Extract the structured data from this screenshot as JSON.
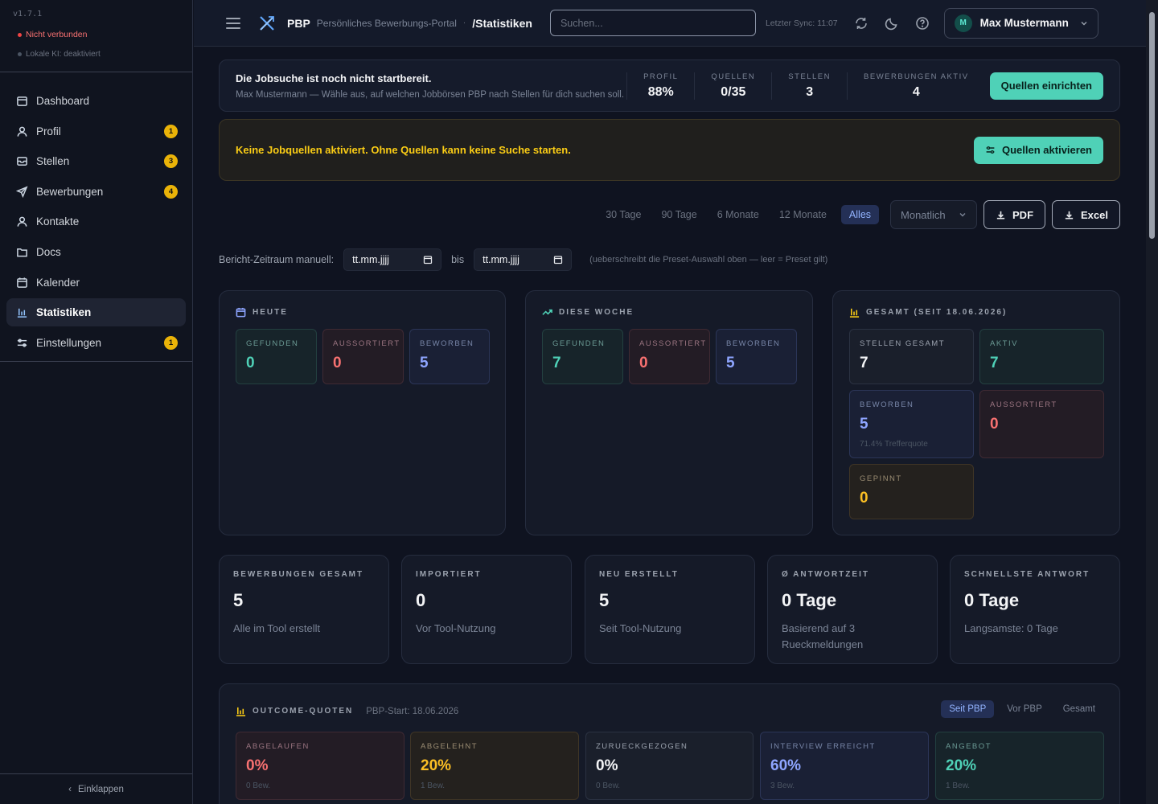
{
  "sidebar": {
    "version": "v1.7.1",
    "connection": "Nicht verbunden",
    "local_ai": "Lokale KI: deaktiviert",
    "items": [
      {
        "label": "Dashboard",
        "badge": ""
      },
      {
        "label": "Profil",
        "badge": "1"
      },
      {
        "label": "Stellen",
        "badge": "3"
      },
      {
        "label": "Bewerbungen",
        "badge": "4"
      },
      {
        "label": "Kontakte",
        "badge": ""
      },
      {
        "label": "Docs",
        "badge": ""
      },
      {
        "label": "Kalender",
        "badge": ""
      },
      {
        "label": "Statistiken",
        "badge": ""
      },
      {
        "label": "Einstellungen",
        "badge": "1"
      }
    ],
    "collapse": "Einklappen"
  },
  "header": {
    "brand": "PBP",
    "brand_sub": "Persönliches Bewerbungs-Portal",
    "breadcrumb_sep": "·",
    "crumb": "/Statistiken",
    "search_placeholder": "Suchen...",
    "sync": "Letzter Sync: 11:07",
    "avatar": "M",
    "user": "Max Mustermann"
  },
  "ready": {
    "title": "Die Jobsuche ist noch nicht startbereit.",
    "subtitle": "Max Mustermann — Wähle aus, auf welchen Jobbörsen PBP nach Stellen für dich suchen soll.",
    "kpis": [
      {
        "label": "PROFIL",
        "value": "88%"
      },
      {
        "label": "QUELLEN",
        "value": "0/35"
      },
      {
        "label": "STELLEN",
        "value": "3"
      },
      {
        "label": "BEWERBUNGEN AKTIV",
        "value": "4"
      }
    ],
    "button": "Quellen einrichten"
  },
  "warning": {
    "text": "Keine Jobquellen aktiviert. Ohne Quellen kann keine Suche starten.",
    "button": "Quellen aktivieren"
  },
  "filters": {
    "presets": [
      "30 Tage",
      "90 Tage",
      "6 Monate",
      "12 Monate",
      "Alles"
    ],
    "active": "Alles",
    "interval": "Monatlich",
    "pdf": "PDF",
    "excel": "Excel"
  },
  "range": {
    "label": "Bericht-Zeitraum manuell:",
    "from": "tt.mm.jjjj",
    "to_label": "bis",
    "to": "tt.mm.jjjj",
    "note": "(ueberschreibt die Preset-Auswahl oben — leer = Preset gilt)"
  },
  "today": {
    "title": "HEUTE",
    "cards": [
      {
        "label": "GEFUNDEN",
        "value": "0"
      },
      {
        "label": "AUSSORTIERT",
        "value": "0"
      },
      {
        "label": "BEWORBEN",
        "value": "5"
      }
    ]
  },
  "week": {
    "title": "DIESE WOCHE",
    "cards": [
      {
        "label": "GEFUNDEN",
        "value": "7"
      },
      {
        "label": "AUSSORTIERT",
        "value": "0"
      },
      {
        "label": "BEWORBEN",
        "value": "5"
      }
    ]
  },
  "total": {
    "title": "GESAMT (SEIT 18.06.2026)",
    "cards": [
      {
        "label": "STELLEN GESAMT",
        "value": "7"
      },
      {
        "label": "AKTIV",
        "value": "7"
      },
      {
        "label": "BEWORBEN",
        "value": "5",
        "sub": "71.4% Trefferquote"
      },
      {
        "label": "AUSSORTIERT",
        "value": "0"
      },
      {
        "label": "GEPINNT",
        "value": "0"
      }
    ]
  },
  "stats": [
    {
      "label": "BEWERBUNGEN GESAMT",
      "value": "5",
      "sub": "Alle im Tool erstellt"
    },
    {
      "label": "IMPORTIERT",
      "value": "0",
      "sub": "Vor Tool-Nutzung"
    },
    {
      "label": "NEU ERSTELLT",
      "value": "5",
      "sub": "Seit Tool-Nutzung"
    },
    {
      "label": "Ø ANTWORTZEIT",
      "value": "0 Tage",
      "sub": "Basierend auf 3 Rueckmeldungen"
    },
    {
      "label": "SCHNELLSTE ANTWORT",
      "value": "0 Tage",
      "sub": "Langsamste: 0 Tage"
    }
  ],
  "outcome": {
    "title": "OUTCOME-QUOTEN",
    "start": "PBP-Start: 18.06.2026",
    "tabs": [
      "Seit PBP",
      "Vor PBP",
      "Gesamt"
    ],
    "cards": [
      {
        "label": "ABGELAUFEN",
        "value": "0%",
        "sub": "0 Bew."
      },
      {
        "label": "ABGELEHNT",
        "value": "20%",
        "sub": "1 Bew."
      },
      {
        "label": "ZURUECKGEZOGEN",
        "value": "0%",
        "sub": "0 Bew."
      },
      {
        "label": "INTERVIEW ERREICHT",
        "value": "60%",
        "sub": "3 Bew."
      },
      {
        "label": "ANGEBOT",
        "value": "20%",
        "sub": "1 Bew."
      }
    ]
  }
}
